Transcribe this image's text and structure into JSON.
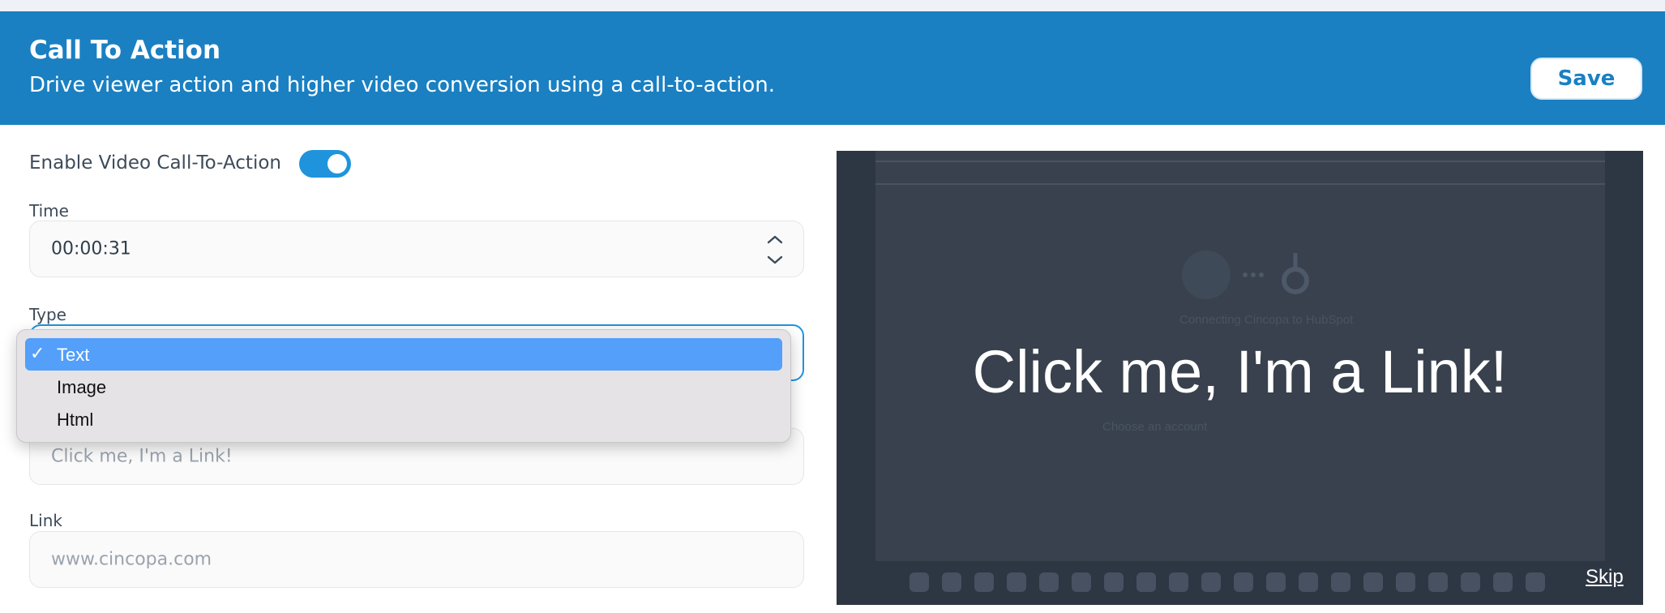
{
  "header": {
    "title": "Call To Action",
    "subtitle": "Drive viewer action and higher video conversion using a call-to-action.",
    "save_label": "Save",
    "bg_color": "#1a80c2"
  },
  "form": {
    "enable_label": "Enable Video Call-To-Action",
    "enabled": true,
    "time_label": "Time",
    "time_value": "00:00:31",
    "type_label": "Type",
    "type_options": [
      {
        "label": "Text",
        "selected": true
      },
      {
        "label": "Image",
        "selected": false
      },
      {
        "label": "Html",
        "selected": false
      }
    ],
    "text_placeholder": "Click me, I'm a Link!",
    "link_label": "Link",
    "link_placeholder": "www.cincopa.com"
  },
  "preview": {
    "cta_text": "Click me, I'm a Link!",
    "skip_label": "Skip",
    "background_caption": "Connecting Cincopa to HubSpot",
    "background_subcaption": "Choose an account"
  }
}
